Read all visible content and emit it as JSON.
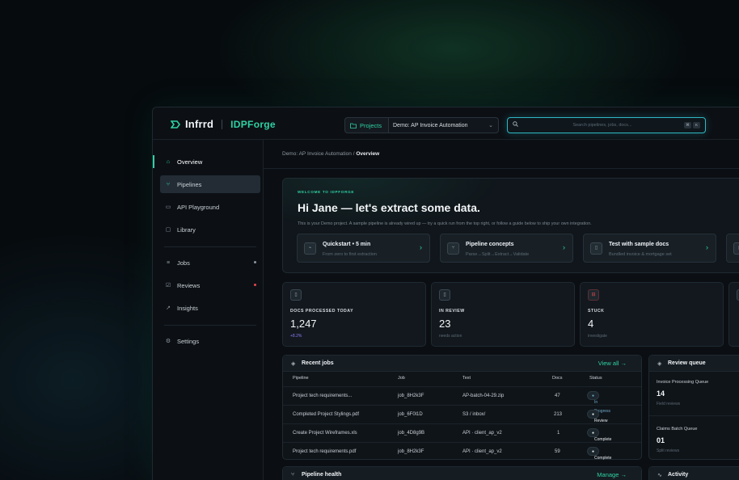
{
  "brand": {
    "company": "Infrrd",
    "product": "IDPForge"
  },
  "topbar": {
    "projects_label": "Projects",
    "project_value": "Demo: AP Invoice Automation",
    "search_placeholder": "Search pipelines, jobs, docs...",
    "shortcut_keys": [
      "⌘",
      "K"
    ]
  },
  "sidebar": {
    "items": [
      {
        "label": "Overview",
        "icon": "home-icon"
      },
      {
        "label": "Pipelines",
        "icon": "pipeline-icon"
      },
      {
        "label": "API Playground",
        "icon": "terminal-icon"
      },
      {
        "label": "Library",
        "icon": "library-icon"
      },
      {
        "label": "Jobs",
        "icon": "list-icon",
        "dot_color": "#8d97a0"
      },
      {
        "label": "Reviews",
        "icon": "check-square-icon",
        "dot_color": "#e5484d"
      },
      {
        "label": "Insights",
        "icon": "chart-icon"
      },
      {
        "label": "Settings",
        "icon": "gear-icon"
      }
    ]
  },
  "breadcrumb": {
    "parent": "Demo: AP Invoice Automation",
    "separator": "/",
    "current": "Overview"
  },
  "welcome": {
    "kicker": "WELCOME TO IDPFORGE",
    "title": "Hi Jane — let's extract some data.",
    "subtitle": "This is your Demo project. A sample pipeline is already wired up — try a quick run from the top right, or follow a guide below to ship your own integration.",
    "guides": [
      {
        "title": "Quickstart • 5 min",
        "subtitle": "From zero to first extraction",
        "icon": "bolt-icon"
      },
      {
        "title": "Pipeline concepts",
        "subtitle": "Parse→Split→Extract→Validate",
        "icon": "branch-icon"
      },
      {
        "title": "Test with sample docs",
        "subtitle": "Bundled invoice & mortgage set",
        "icon": "doc-icon"
      }
    ]
  },
  "stats": [
    {
      "label": "DOCS PROCESSED TODAY",
      "value": "1,247",
      "sub": "+8.2%",
      "sub_color": "#8b7cf6",
      "icon": "doc-icon",
      "icon_color": "#8d97a0"
    },
    {
      "label": "IN REVIEW",
      "value": "23",
      "sub": "needs action",
      "sub_color": "#5d6a73",
      "icon": "doc-icon",
      "icon_color": "#8d97a0"
    },
    {
      "label": "STUCK",
      "value": "4",
      "sub": "investigate",
      "sub_color": "#5d6a73",
      "icon": "inbox-icon",
      "icon_color": "#e5484d"
    }
  ],
  "recent_jobs": {
    "title": "Recent jobs",
    "link": "View all",
    "columns": [
      "Pipeline",
      "Job",
      "Text",
      "Docs",
      "Status"
    ],
    "rows": [
      {
        "pipeline": "Project tech requirements...",
        "job": "job_8H2k3F",
        "text": "AP-batch-04-29.zip",
        "docs": "47",
        "status": "In Progress",
        "status_kind": "prog"
      },
      {
        "pipeline": "Completed Project Stylings.pdf",
        "job": "job_6F0l1D",
        "text": "S3 / inbox/",
        "docs": "213",
        "status": "Review",
        "status_kind": "review"
      },
      {
        "pipeline": "Create Project Wireframes.xls",
        "job": "job_4D8g9B",
        "text": "API · client_ap_v2",
        "docs": "1",
        "status": "Complete",
        "status_kind": "ok"
      },
      {
        "pipeline": "Project tech requirements.pdf",
        "job": "job_8H2k3F",
        "text": "API · client_ap_v2",
        "docs": "59",
        "status": "Complete",
        "status_kind": "ok"
      }
    ]
  },
  "review_queue": {
    "title": "Review queue",
    "items": [
      {
        "name": "Invoice Processing Queue",
        "count": "14",
        "sub": "Field reviews"
      },
      {
        "name": "Claims Batch Queue",
        "count": "01",
        "sub": "Split reviews"
      }
    ]
  },
  "pipeline_health": {
    "title": "Pipeline health",
    "link": "Manage"
  },
  "activity": {
    "title": "Activity"
  },
  "colors": {
    "accent": "#2fd1a3",
    "danger": "#e5484d",
    "purple": "#8b7cf6"
  }
}
